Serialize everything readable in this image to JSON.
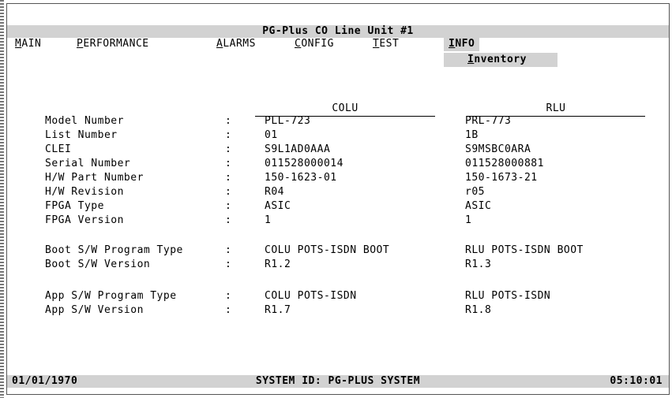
{
  "window": {
    "title": "PG-Plus CO Line Unit #1"
  },
  "menu": {
    "main": {
      "hot": "M",
      "rest": "AIN"
    },
    "performance": {
      "hot": "P",
      "rest": "ERFORMANCE"
    },
    "alarms": {
      "hot": "A",
      "rest": "LARMS"
    },
    "config": {
      "hot": "C",
      "rest": "ONFIG"
    },
    "test": {
      "hot": "T",
      "rest": "EST"
    },
    "info": {
      "hot": "I",
      "rest": "NFO"
    }
  },
  "submenu": {
    "hot": "I",
    "rest": "nventory"
  },
  "columns": {
    "colu": "COLU",
    "rlu": "RLU"
  },
  "separator": ":",
  "rows": [
    {
      "label": "Model Number",
      "colu": "PLL-723",
      "rlu": "PRL-773"
    },
    {
      "label": "List Number",
      "colu": "01",
      "rlu": "1B"
    },
    {
      "label": "CLEI",
      "colu": "S9L1AD0AAA",
      "rlu": "S9MSBC0ARA"
    },
    {
      "label": "Serial Number",
      "colu": "011528000014",
      "rlu": "011528000881"
    },
    {
      "label": "H/W Part Number",
      "colu": "150-1623-01",
      "rlu": "150-1673-21"
    },
    {
      "label": "H/W Revision",
      "colu": "R04",
      "rlu": "r05"
    },
    {
      "label": "FPGA Type",
      "colu": "ASIC",
      "rlu": "ASIC"
    },
    {
      "label": "FPGA Version",
      "colu": "1",
      "rlu": "1"
    },
    {
      "label": "Boot S/W Program Type",
      "colu": "COLU POTS-ISDN BOOT",
      "rlu": "RLU POTS-ISDN BOOT"
    },
    {
      "label": "Boot S/W Version",
      "colu": "R1.2",
      "rlu": "R1.3"
    },
    {
      "label": "App S/W Program Type",
      "colu": "COLU POTS-ISDN",
      "rlu": "RLU POTS-ISDN"
    },
    {
      "label": "App S/W Version",
      "colu": "R1.7",
      "rlu": "R1.8"
    }
  ],
  "footer": {
    "date": "01/01/1970",
    "system": "SYSTEM ID: PG-PLUS SYSTEM",
    "time": "05:10:01"
  }
}
